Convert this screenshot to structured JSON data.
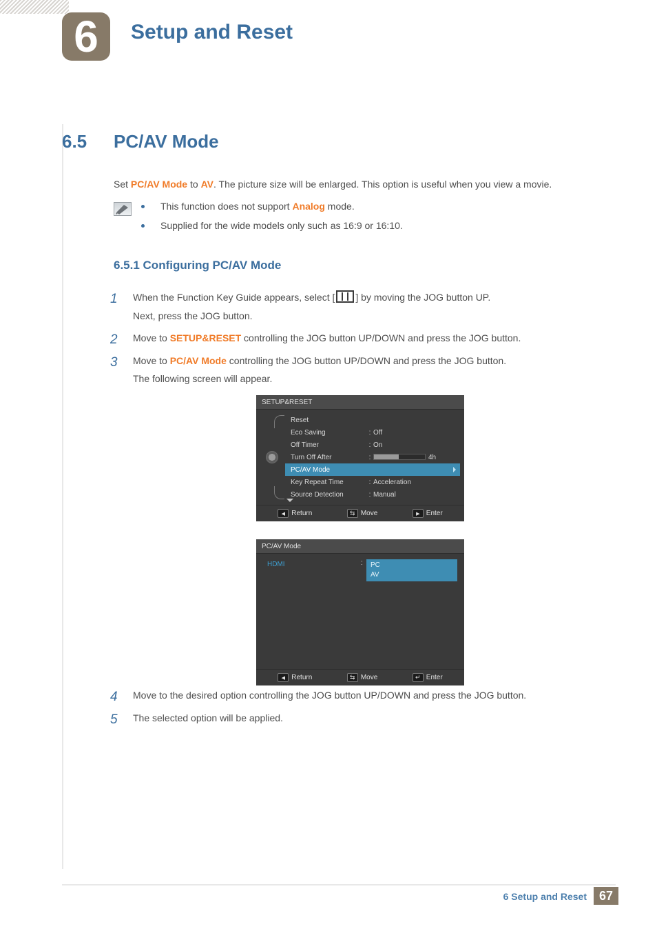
{
  "header": {
    "chapter_number": "6",
    "chapter_title": "Setup and Reset"
  },
  "section": {
    "number": "6.5",
    "title": "PC/AV Mode",
    "intro_pre": "Set ",
    "intro_hl1": "PC/AV Mode",
    "intro_mid": " to ",
    "intro_hl2": "AV",
    "intro_post": ". The picture size will be enlarged. This option is useful when you view a movie."
  },
  "notes": {
    "item1_pre": "This function does not support ",
    "item1_hl": "Analog",
    "item1_post": " mode.",
    "item2": "Supplied for the wide models only such as 16:9 or 16:10."
  },
  "subsection": {
    "number_title": "6.5.1   Configuring PC/AV Mode"
  },
  "steps": {
    "s1a": "When the Function Key Guide appears, select ",
    "s1b": " by moving the JOG button UP.",
    "s1c": "Next, press the JOG button.",
    "s2a": "Move to ",
    "s2hl": "SETUP&RESET",
    "s2b": " controlling the JOG button UP/DOWN and press the JOG button.",
    "s3a": "Move to ",
    "s3hl": "PC/AV Mode",
    "s3b": " controlling the JOG button UP/DOWN and press the JOG button.",
    "s3c": "The following screen will appear.",
    "s4": "Move to the desired option controlling the JOG button UP/DOWN and press the JOG button.",
    "s5": "The selected option will be applied."
  },
  "osd1": {
    "title": "SETUP&RESET",
    "rows": {
      "reset": "Reset",
      "eco_saving": "Eco Saving",
      "eco_saving_val": "Off",
      "off_timer": "Off Timer",
      "off_timer_val": "On",
      "turn_off_after": "Turn Off After",
      "turn_off_after_val": "4h",
      "pcav": "PC/AV Mode",
      "key_repeat": "Key Repeat Time",
      "key_repeat_val": "Acceleration",
      "source_detection": "Source Detection",
      "source_detection_val": "Manual"
    },
    "hints": {
      "return": "Return",
      "move": "Move",
      "enter": "Enter"
    }
  },
  "osd2": {
    "title": "PC/AV Mode",
    "input_label": "HDMI",
    "opt1": "PC",
    "opt2": "AV",
    "hints": {
      "return": "Return",
      "move": "Move",
      "enter": "Enter"
    }
  },
  "footer": {
    "label": "6 Setup and Reset",
    "page": "67"
  },
  "chart_data": null
}
